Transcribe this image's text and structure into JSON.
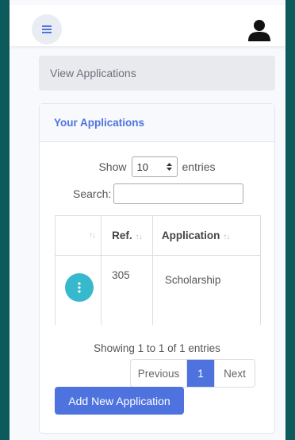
{
  "topbar": {
    "menu_icon": "hamburger-icon",
    "user_icon": "user-icon"
  },
  "breadcrumb": {
    "label": "View Applications"
  },
  "card": {
    "title": "Your Applications",
    "show_label": "Show",
    "entries_value": "10",
    "entries_label": "entries",
    "search_label": "Search:",
    "search_value": "",
    "columns": [
      "",
      "Ref.",
      "Application"
    ],
    "rows": [
      {
        "ref": "305",
        "application": "Scholarship",
        "action_icon": "more-vertical-icon"
      }
    ],
    "info": "Showing 1 to 1 of 1 entries",
    "pager": {
      "previous": "Previous",
      "current": "1",
      "next": "Next"
    },
    "add_button": "Add New Application"
  },
  "colors": {
    "background": "#0d5a5c",
    "primary": "#4e73df",
    "info": "#36b9cc"
  }
}
